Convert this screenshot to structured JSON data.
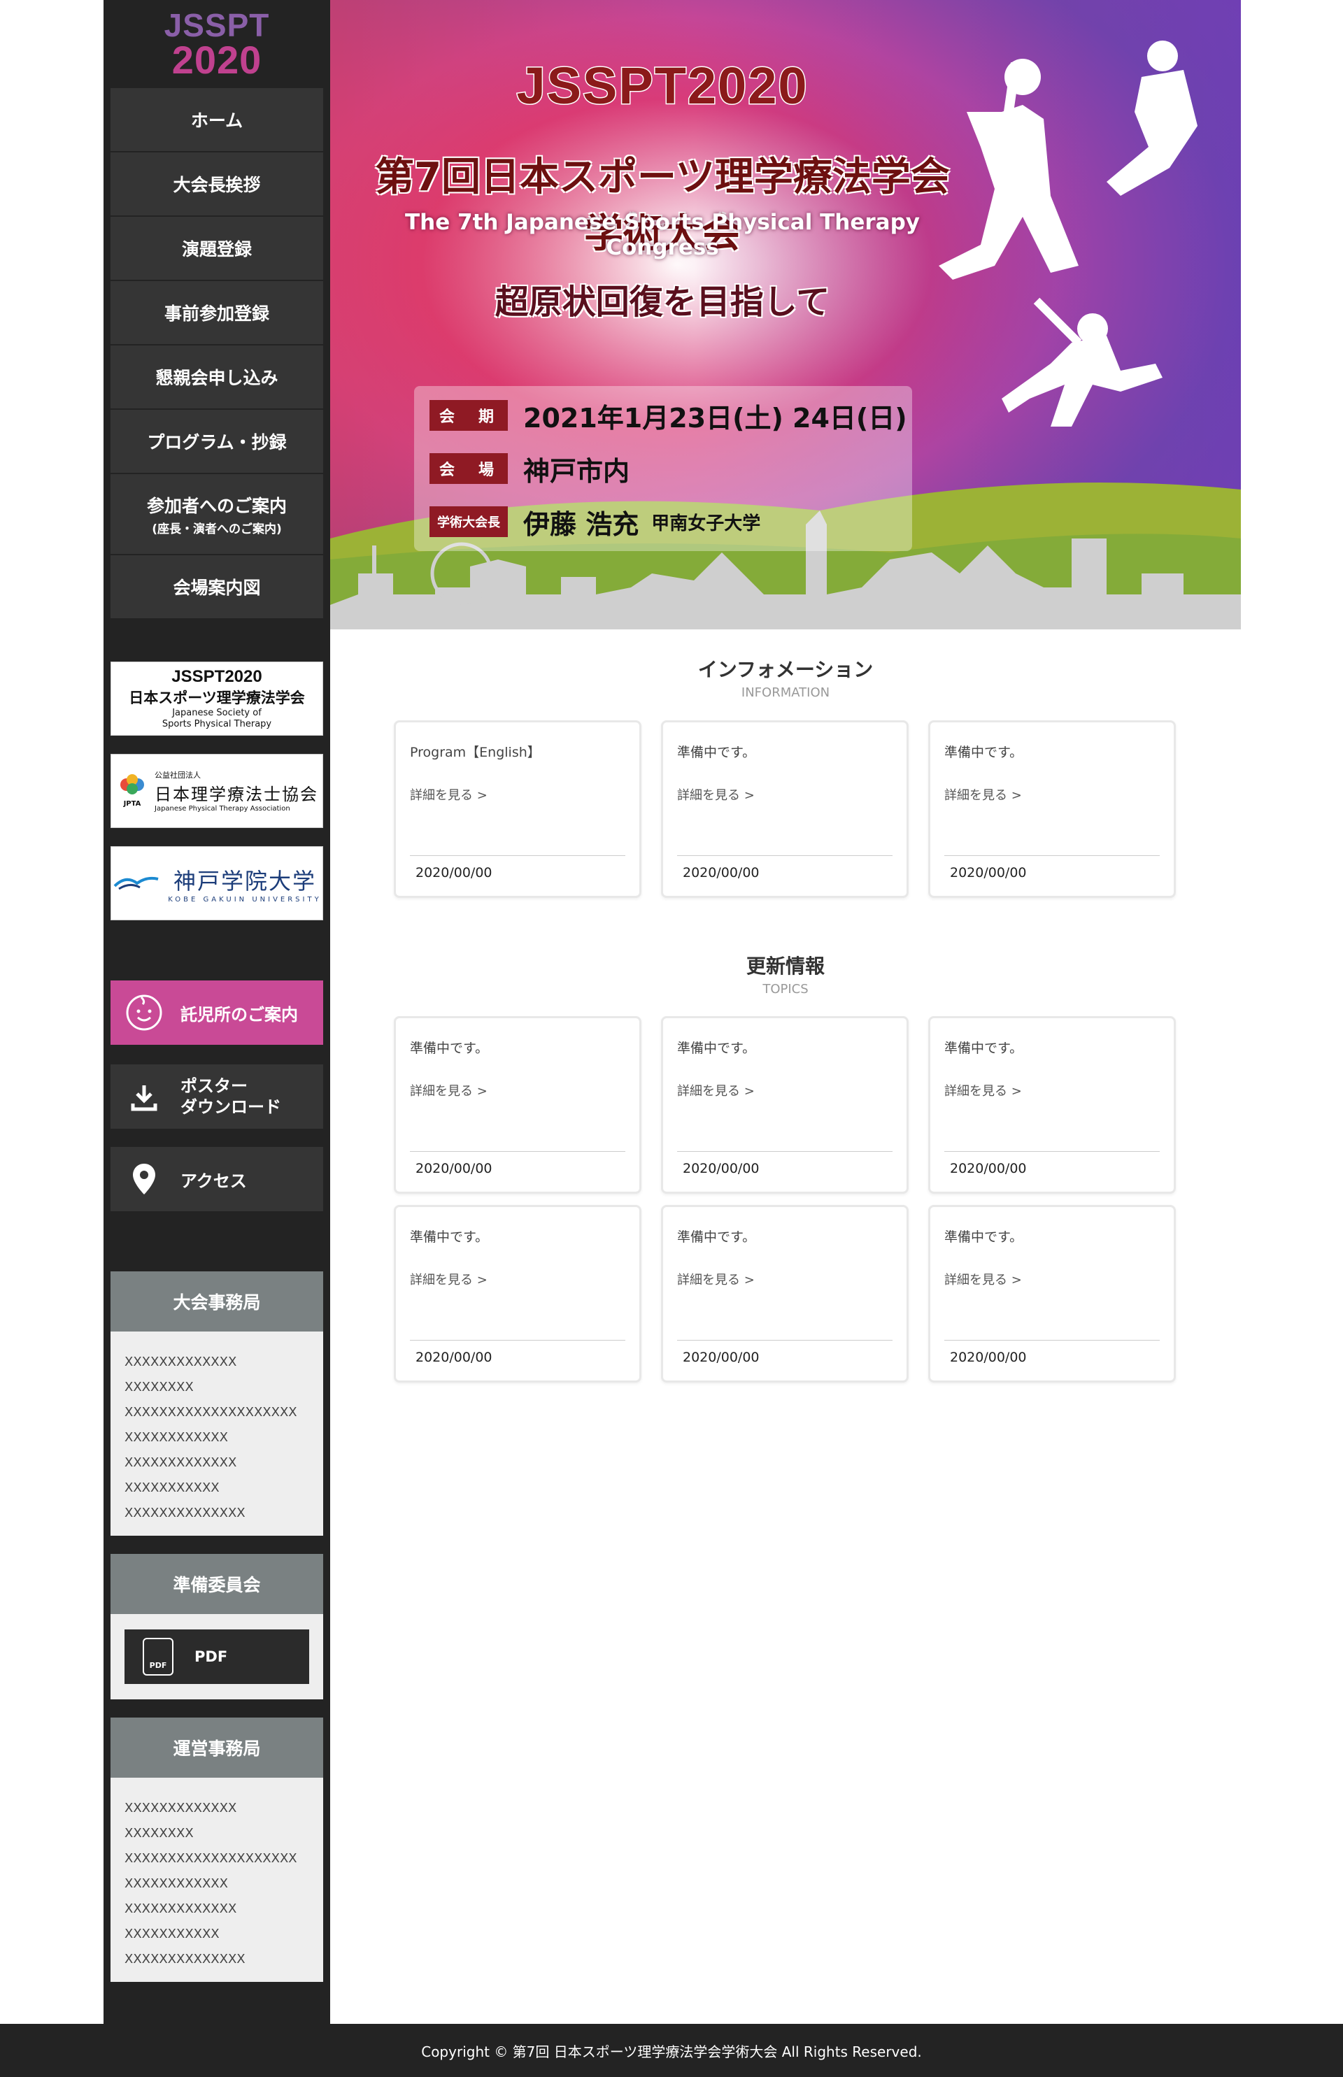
{
  "logo": {
    "line1": "JSSPT",
    "line2": "2020"
  },
  "nav": [
    {
      "label": "ホーム"
    },
    {
      "label": "大会長挨拶"
    },
    {
      "label": "演題登録"
    },
    {
      "label": "事前参加登録"
    },
    {
      "label": "懇親会申し込み"
    },
    {
      "label": "プログラム・抄録"
    },
    {
      "label": "参加者へのご案内",
      "sub": "(座長・演者へのご案内)"
    },
    {
      "label": "会場案内図"
    }
  ],
  "banners": {
    "jsspt": {
      "t1": "JSSPT2020",
      "t2": "日本スポーツ理学療法学会",
      "t3a": "Japanese Society of",
      "t3b": "Sports Physical Therapy"
    },
    "jpta": {
      "small": "公益社団法人",
      "big": "日本理学療法士協会",
      "abbr": "JPTA",
      "en": "Japanese Physical Therapy Association"
    },
    "kobe": {
      "big": "神戸学院大学",
      "en": "KOBE GAKUIN UNIVERSITY"
    }
  },
  "actions": {
    "childcare": "託児所のご案内",
    "poster_line1": "ポスター",
    "poster_line2": "ダウンロード",
    "access": "アクセス"
  },
  "office": {
    "title": "大会事務局",
    "lines": [
      "XXXXXXXXXXXXX",
      "XXXXXXXX",
      "XXXXXXXXXXXXXXXXXXXX",
      "XXXXXXXXXXXX",
      "XXXXXXXXXXXXX",
      "XXXXXXXXXXX",
      "XXXXXXXXXXXXXX"
    ]
  },
  "committee": {
    "title": "準備委員会",
    "pdf_label": "PDF",
    "pdf_icon_text": "PDF"
  },
  "operations": {
    "title": "運営事務局",
    "lines": [
      "XXXXXXXXXXXXX",
      "XXXXXXXX",
      "XXXXXXXXXXXXXXXXXXXX",
      "XXXXXXXXXXXX",
      "XXXXXXXXXXXXX",
      "XXXXXXXXXXX",
      "XXXXXXXXXXXXXX"
    ]
  },
  "hero": {
    "title": "JSSPT2020",
    "jp": "第7回日本スポーツ理学療法学会学術大会",
    "en": "The 7th Japanese Sports Physical Therapy Congress",
    "motto": "超原状回復を目指して",
    "period_label": "会　期",
    "period_value": "2021年1月23日(土) 24日(日)",
    "venue_label": "会　場",
    "venue_value": "神戸市内",
    "president_label": "学術大会長",
    "president_name": "伊藤 浩充",
    "president_affil": "甲南女子大学"
  },
  "information": {
    "title": "インフォメーション",
    "subtitle": "INFORMATION",
    "cards": [
      {
        "title": "Program【English】",
        "link": "詳細を見る >",
        "date": "2020/00/00"
      },
      {
        "title": "準備中です。",
        "link": "詳細を見る >",
        "date": "2020/00/00"
      },
      {
        "title": "準備中です。",
        "link": "詳細を見る >",
        "date": "2020/00/00"
      }
    ]
  },
  "topics": {
    "title": "更新情報",
    "subtitle": "TOPICS",
    "cards": [
      {
        "title": "準備中です。",
        "link": "詳細を見る >",
        "date": "2020/00/00"
      },
      {
        "title": "準備中です。",
        "link": "詳細を見る >",
        "date": "2020/00/00"
      },
      {
        "title": "準備中です。",
        "link": "詳細を見る >",
        "date": "2020/00/00"
      },
      {
        "title": "準備中です。",
        "link": "詳細を見る >",
        "date": "2020/00/00"
      },
      {
        "title": "準備中です。",
        "link": "詳細を見る >",
        "date": "2020/00/00"
      },
      {
        "title": "準備中です。",
        "link": "詳細を見る >",
        "date": "2020/00/00"
      }
    ]
  },
  "footer": {
    "copyright": "Copyright © 第7回 日本スポーツ理学療法学会学術大会 All Rights Reserved."
  },
  "colors": {
    "sidebar": "#232323",
    "nav_item": "#353535",
    "accent_pink": "#c94a96",
    "label_red": "#8f1a24",
    "box_header": "#7a8182"
  }
}
